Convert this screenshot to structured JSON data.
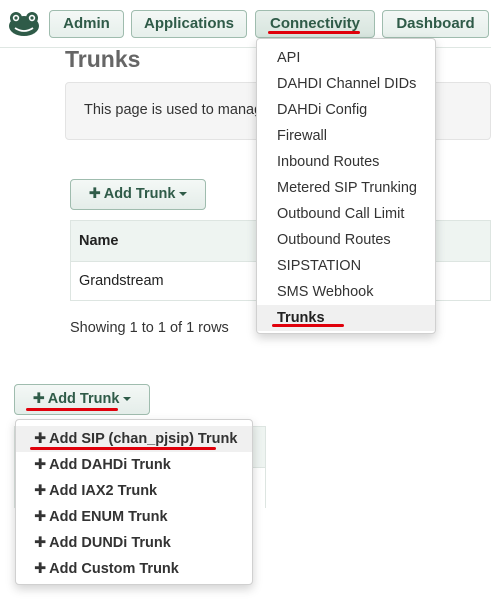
{
  "nav": {
    "admin": "Admin",
    "applications": "Applications",
    "connectivity": "Connectivity",
    "dashboard": "Dashboard"
  },
  "page": {
    "title": "Trunks",
    "info": "This page is used to manage"
  },
  "add_trunk_label": "Add Trunk",
  "table": {
    "header_name": "Name",
    "rows": [
      "Grandstream"
    ]
  },
  "showing": "Showing 1 to 1 of 1 rows",
  "connectivity_menu": [
    "API",
    "DAHDI Channel DIDs",
    "DAHDi Config",
    "Firewall",
    "Inbound Routes",
    "Metered SIP Trunking",
    "Outbound Call Limit",
    "Outbound Routes",
    "SIPSTATION",
    "SMS Webhook",
    "Trunks"
  ],
  "add_trunk_menu": [
    "Add SIP (chan_pjsip) Trunk",
    "Add DAHDi Trunk",
    "Add IAX2 Trunk",
    "Add ENUM Trunk",
    "Add DUNDi Trunk",
    "Add Custom Trunk"
  ],
  "icons": {
    "logo": "frog-logo-icon",
    "plus": "plus-icon",
    "caret": "caret-down-icon"
  },
  "colors": {
    "accent": "#2f5b48",
    "highlight_underline": "#e0000b"
  }
}
